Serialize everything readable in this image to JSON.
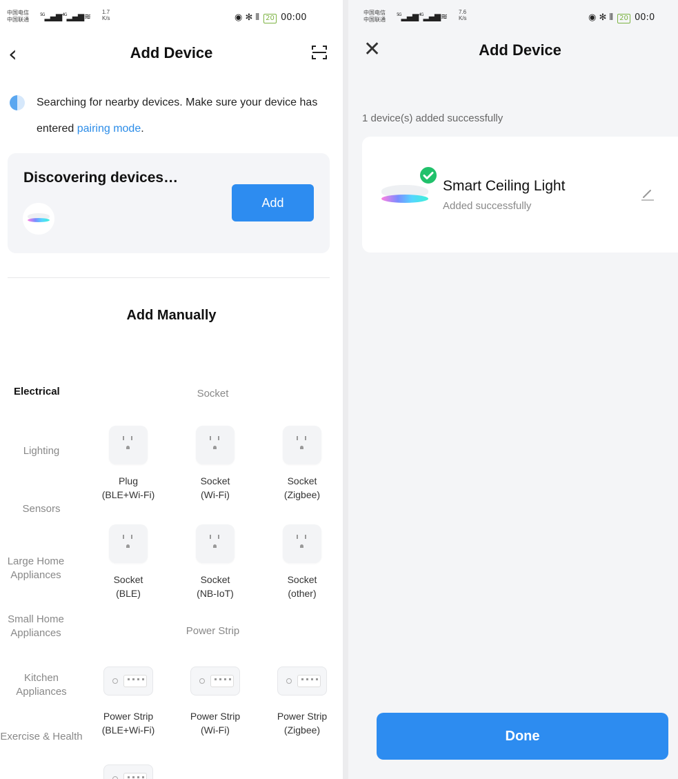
{
  "left": {
    "status": {
      "carrier1": "中国电信",
      "carrier2": "中国联通",
      "net1": "5G",
      "net2": "4G",
      "speed_value": "1.7",
      "speed_unit": "K/s",
      "battery": "20",
      "time": "00:00"
    },
    "nav": {
      "back_icon": "chevron-left-icon",
      "title": "Add Device",
      "scan_icon": "scan-icon"
    },
    "notice": {
      "text": "Searching for nearby devices. Make sure your device has entered ",
      "link": "pairing mode",
      "end": "."
    },
    "discovering": {
      "title": "Discovering devices…",
      "add_label": "Add",
      "device_icon": "ceiling-light-icon"
    },
    "manual_title": "Add Manually",
    "categories": [
      {
        "label": "Electrical",
        "active": true
      },
      {
        "label": "Lighting"
      },
      {
        "label": "Sensors"
      },
      {
        "label": "Large Home Appliances"
      },
      {
        "label": "Small Home Appliances"
      },
      {
        "label": "Kitchen Appliances"
      },
      {
        "label": "Exercise & Health"
      }
    ],
    "sections": {
      "socket": "Socket",
      "power_strip": "Power Strip"
    },
    "socket_items": [
      {
        "line1": "Plug",
        "line2": "(BLE+Wi-Fi)"
      },
      {
        "line1": "Socket",
        "line2": "(Wi-Fi)"
      },
      {
        "line1": "Socket",
        "line2": "(Zigbee)"
      },
      {
        "line1": "Socket",
        "line2": "(BLE)"
      },
      {
        "line1": "Socket",
        "line2": "(NB-IoT)"
      },
      {
        "line1": "Socket",
        "line2": "(other)"
      }
    ],
    "strip_items": [
      {
        "line1": "Power Strip",
        "line2": "(BLE+Wi-Fi)"
      },
      {
        "line1": "Power Strip",
        "line2": "(Wi-Fi)"
      },
      {
        "line1": "Power Strip",
        "line2": "(Zigbee)"
      }
    ]
  },
  "right": {
    "status": {
      "carrier1": "中国电信",
      "carrier2": "中国联通",
      "net1": "5G",
      "net2": "4G",
      "speed_value": "7.6",
      "speed_unit": "K/s",
      "battery": "20",
      "time": "00:0"
    },
    "nav": {
      "close_icon": "close-icon",
      "title": "Add Device"
    },
    "added_count_text": "1 device(s) added successfully",
    "device": {
      "name": "Smart Ceiling Light",
      "status": "Added successfully",
      "icon": "ceiling-light-icon",
      "check_icon": "check-circle-icon",
      "edit_icon": "edit-pencil-icon"
    },
    "done_label": "Done"
  },
  "colors": {
    "accent": "#2d8cf0",
    "success": "#21c16b",
    "link": "#2b8ce8"
  }
}
